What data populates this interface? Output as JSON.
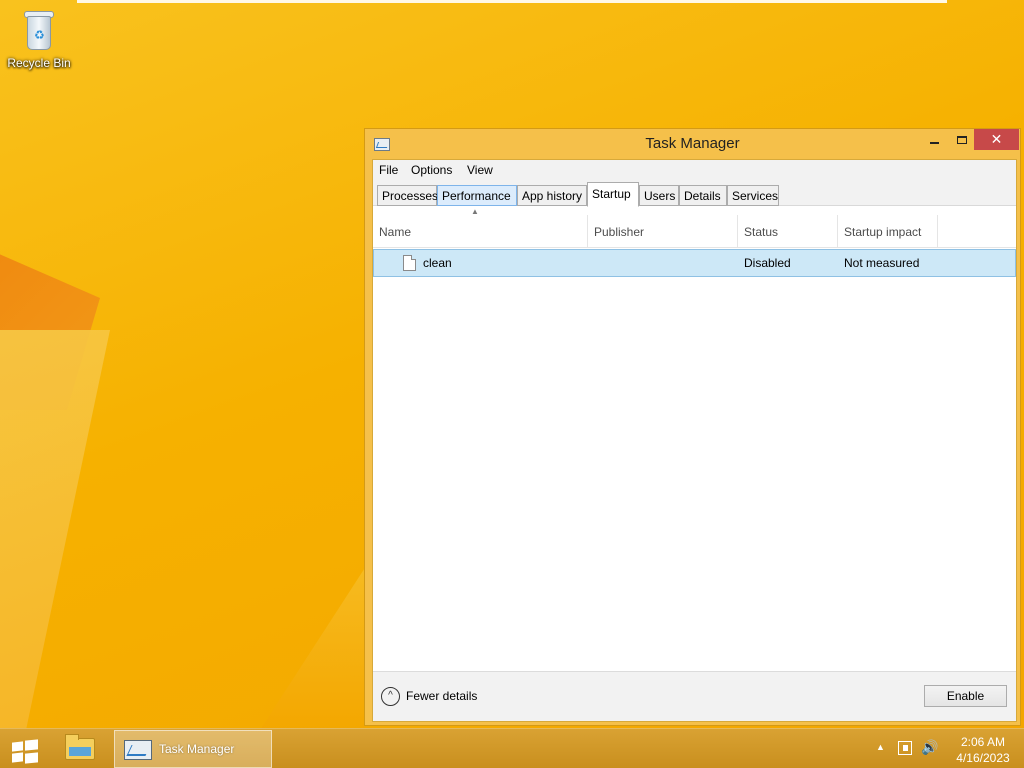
{
  "desktop": {
    "icons": [
      {
        "label": "Recycle Bin",
        "icon": "recycle-bin-icon"
      }
    ]
  },
  "window": {
    "title": "Task Manager",
    "icon": "task-manager-icon",
    "controls": {
      "minimize": "minimize",
      "maximize": "maximize",
      "close": "✕"
    },
    "menu": [
      "File",
      "Options",
      "View"
    ],
    "tabs": [
      "Processes",
      "Performance",
      "App history",
      "Startup",
      "Users",
      "Details",
      "Services"
    ],
    "active_tab": "Startup",
    "hover_tab": "Performance",
    "table": {
      "columns": [
        "Name",
        "Publisher",
        "Status",
        "Startup impact"
      ],
      "rows": [
        {
          "name": "clean",
          "publisher": "",
          "status": "Disabled",
          "impact": "Not measured",
          "selected": true
        }
      ]
    },
    "footer": {
      "fewer_details": "Fewer details",
      "enable_button": "Enable"
    }
  },
  "taskbar": {
    "start": "start-icon",
    "pinned": [
      "file-explorer-icon"
    ],
    "running": [
      {
        "label": "Task Manager",
        "icon": "task-manager-icon"
      }
    ],
    "clock": {
      "time": "2:06 AM",
      "date": "4/16/2023"
    }
  },
  "colors": {
    "desktop": "#f6b400",
    "window_frame": "#f5c04a",
    "close_button": "#c74949",
    "selected_row": "#cde8f7",
    "taskbar": "#d9a233"
  }
}
